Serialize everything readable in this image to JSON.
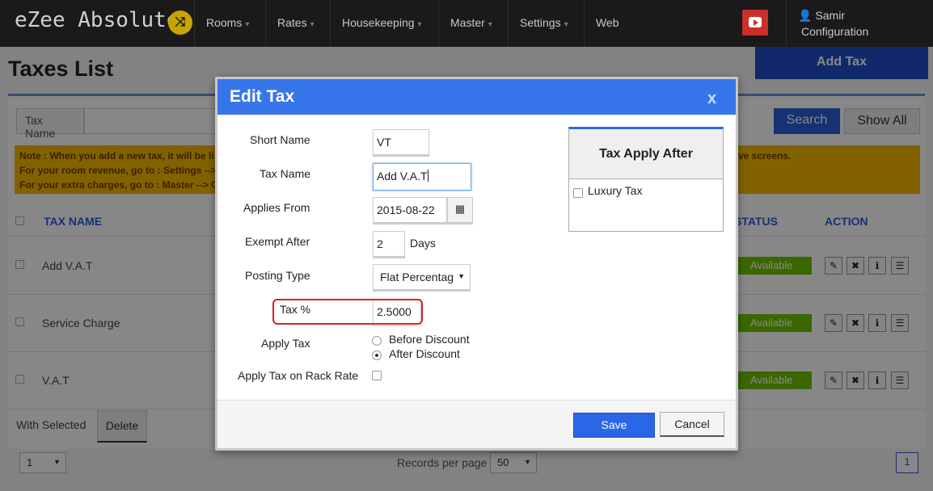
{
  "app": {
    "brand": "eZee Absolute",
    "brand_icon": "shuffle-icon"
  },
  "nav": {
    "items": [
      {
        "label": "Rooms"
      },
      {
        "label": "Rates"
      },
      {
        "label": "Housekeeping"
      },
      {
        "label": "Master"
      },
      {
        "label": "Settings"
      },
      {
        "label": "Web"
      }
    ],
    "user_name": "Samir",
    "user_sub": "Configuration"
  },
  "page": {
    "title": "Taxes List",
    "add_button": "Add Tax",
    "filter_label": "Tax Name",
    "search_button": "Search",
    "show_all_button": "Show All",
    "note_lines": [
      "Note : When you add a new tax, it will be li",
      "For your room revenue, go to : Settings -->",
      "For your extra charges, go to : Master --> G"
    ],
    "note_right": "ve screens.",
    "columns": {
      "tax_name": "TAX NAME",
      "status": "STATUS",
      "action": "ACTION"
    },
    "rows": [
      {
        "name": "Add V.A.T",
        "status": "Available"
      },
      {
        "name": "Service Charge",
        "status": "Available"
      },
      {
        "name": "V.A.T",
        "status": "Available"
      }
    ],
    "with_selected": "With Selected",
    "delete_button": "Delete",
    "page_select": "1",
    "records_per_page_label": "Records per page",
    "records_per_page": "50",
    "current_page": "1"
  },
  "modal": {
    "title": "Edit Tax",
    "close": "x",
    "fields": {
      "short_name_label": "Short Name",
      "short_name_value": "VT",
      "tax_name_label": "Tax Name",
      "tax_name_value": "Add V.A.T",
      "applies_from_label": "Applies From",
      "applies_from_value": "2015-08-22",
      "exempt_after_label": "Exempt After",
      "exempt_after_value": "2",
      "days_label": "Days",
      "posting_type_label": "Posting Type",
      "posting_type_value": "Flat Percentag",
      "tax_percent_label": "Tax %",
      "tax_percent_value": "2.5000",
      "apply_tax_label": "Apply Tax",
      "before_discount": "Before Discount",
      "after_discount": "After Discount",
      "apply_rack_rate_label": "Apply Tax on Rack Rate"
    },
    "tax_apply_after": {
      "title": "Tax Apply After",
      "items": [
        {
          "label": "Luxury Tax",
          "checked": false
        }
      ]
    },
    "save_button": "Save",
    "cancel_button": "Cancel"
  },
  "colors": {
    "primary": "#3776ea",
    "highlight": "#e02020",
    "available": "#6fc200",
    "note": "#f5b800"
  }
}
